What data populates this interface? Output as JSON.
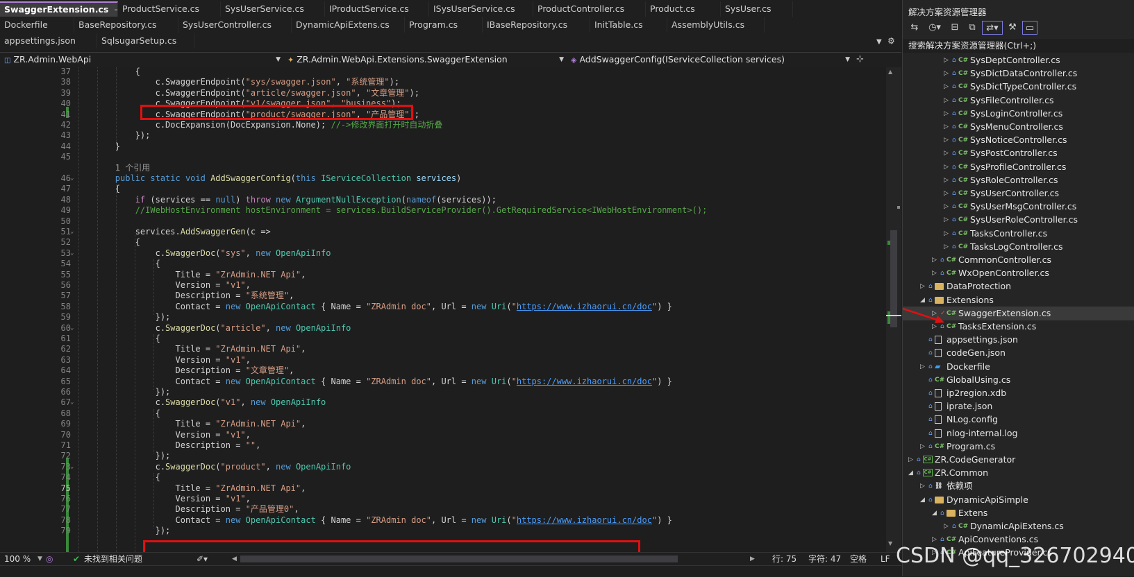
{
  "tabs_row1": [
    "SwaggerExtension.cs",
    "ProductService.cs",
    "SysUserService.cs",
    "IProductService.cs",
    "ISysUserService.cs",
    "ProductController.cs",
    "Product.cs",
    "SysUser.cs"
  ],
  "tabs_row2": [
    "Dockerfile",
    "BaseRepository.cs",
    "SysUserController.cs",
    "DynamicApiExtens.cs",
    "Program.cs",
    "IBaseRepository.cs",
    "InitTable.cs",
    "AssemblyUtils.cs"
  ],
  "tabs_row3": [
    "appsettings.json",
    "SqlsugarSetup.cs"
  ],
  "active_tab_pin": "⊣",
  "active_tab_close": "✕",
  "nav": {
    "project": "ZR.Admin.WebApi",
    "type": "ZR.Admin.WebApi.Extensions.SwaggerExtension",
    "member": "AddSwaggerConfig(IServiceCollection services)"
  },
  "code_lines": [
    {
      "n": "37",
      "html": "            {"
    },
    {
      "n": "38",
      "html": "                c.SwaggerEndpoint(<span class='s'>\"sys/swagger.json\"</span>, <span class='s'>\"系统管理\"</span>);"
    },
    {
      "n": "39",
      "html": "                c.SwaggerEndpoint(<span class='s'>\"article/swagger.json\"</span>, <span class='s'>\"文章管理\"</span>);"
    },
    {
      "n": "40",
      "html": "                c.SwaggerEndpoint(<span class='s'>\"v1/swagger.json\"</span>, <span class='s'>\"business\"</span>);"
    },
    {
      "n": "41",
      "html": "                c.SwaggerEndpoint(<span class='s'>\"product/swagger.json\"</span>, <span class='s'>\"产品管理\"</span>);"
    },
    {
      "n": "42",
      "html": "                c.DocExpansion(DocExpansion.None); <span class='c'>//->修改界面打开时自动折叠</span>"
    },
    {
      "n": "43",
      "html": "            });"
    },
    {
      "n": "44",
      "html": "        }"
    },
    {
      "n": "45",
      "html": ""
    },
    {
      "n": "",
      "html": "        <span style='color:#999'>1 个引用</span>"
    },
    {
      "n": "46",
      "html": "        <span class='k'>public static void</span> <span class='m'>AddSwaggerConfig</span>(<span class='k'>this</span> <span class='t'>IServiceCollection</span> <span class='r'>services</span>)"
    },
    {
      "n": "47",
      "html": "        {"
    },
    {
      "n": "48",
      "html": "            <span class='cl'>if</span> (services == <span class='k'>null</span>) <span class='cl'>throw</span> <span class='k'>new</span> <span class='t'>ArgumentNullException</span>(<span class='k'>nameof</span>(services));"
    },
    {
      "n": "49",
      "html": "            <span class='c'>//IWebHostEnvironment hostEnvironment = services.BuildServiceProvider().GetRequiredService&lt;IWebHostEnvironment&gt;();</span>"
    },
    {
      "n": "50",
      "html": ""
    },
    {
      "n": "51",
      "html": "            services.<span class='m'>AddSwaggerGen</span>(c =&gt;"
    },
    {
      "n": "52",
      "html": "            {"
    },
    {
      "n": "53",
      "html": "                c.<span class='m'>SwaggerDoc</span>(<span class='s'>\"sys\"</span>, <span class='k'>new</span> <span class='t'>OpenApiInfo</span>"
    },
    {
      "n": "54",
      "html": "                {"
    },
    {
      "n": "55",
      "html": "                    Title = <span class='s'>\"ZrAdmin.NET Api\"</span>,"
    },
    {
      "n": "56",
      "html": "                    Version = <span class='s'>\"v1\"</span>,"
    },
    {
      "n": "57",
      "html": "                    Description = <span class='s'>\"系统管理\"</span>,"
    },
    {
      "n": "58",
      "html": "                    Contact = <span class='k'>new</span> <span class='t'>OpenApiContact</span> { Name = <span class='s'>\"ZRAdmin doc\"</span>, Url = <span class='k'>new</span> <span class='t'>Uri</span>(<span class='s'>\"</span><span class='u'>https://www.izhaorui.cn/doc</span><span class='s'>\"</span>) }"
    },
    {
      "n": "59",
      "html": "                });"
    },
    {
      "n": "60",
      "html": "                c.<span class='m'>SwaggerDoc</span>(<span class='s'>\"article\"</span>, <span class='k'>new</span> <span class='t'>OpenApiInfo</span>"
    },
    {
      "n": "61",
      "html": "                {"
    },
    {
      "n": "62",
      "html": "                    Title = <span class='s'>\"ZrAdmin.NET Api\"</span>,"
    },
    {
      "n": "63",
      "html": "                    Version = <span class='s'>\"v1\"</span>,"
    },
    {
      "n": "64",
      "html": "                    Description = <span class='s'>\"文章管理\"</span>,"
    },
    {
      "n": "65",
      "html": "                    Contact = <span class='k'>new</span> <span class='t'>OpenApiContact</span> { Name = <span class='s'>\"ZRAdmin doc\"</span>, Url = <span class='k'>new</span> <span class='t'>Uri</span>(<span class='s'>\"</span><span class='u'>https://www.izhaorui.cn/doc</span><span class='s'>\"</span>) }"
    },
    {
      "n": "66",
      "html": "                });"
    },
    {
      "n": "67",
      "html": "                c.<span class='m'>SwaggerDoc</span>(<span class='s'>\"v1\"</span>, <span class='k'>new</span> <span class='t'>OpenApiInfo</span>"
    },
    {
      "n": "68",
      "html": "                {"
    },
    {
      "n": "69",
      "html": "                    Title = <span class='s'>\"ZrAdmin.NET Api\"</span>,"
    },
    {
      "n": "70",
      "html": "                    Version = <span class='s'>\"v1\"</span>,"
    },
    {
      "n": "71",
      "html": "                    Description = <span class='s'>\"\"</span>,"
    },
    {
      "n": "72",
      "html": "                });"
    },
    {
      "n": "73",
      "html": "                c.<span class='m'>SwaggerDoc</span>(<span class='s'>\"product\"</span>, <span class='k'>new</span> <span class='t'>OpenApiInfo</span>"
    },
    {
      "n": "74",
      "html": "                {"
    },
    {
      "n": "75",
      "html": "                    Title = <span class='s'>\"ZrAdmin.NET Api\"</span>,"
    },
    {
      "n": "76",
      "html": "                    Version = <span class='s'>\"v1\"</span>,"
    },
    {
      "n": "77",
      "html": "                    Description = <span class='s'>\"产品管理0\"</span>,"
    },
    {
      "n": "78",
      "html": "                    Contact = <span class='k'>new</span> <span class='t'>OpenApiContact</span> { Name = <span class='s'>\"ZRAdmin doc\"</span>, Url = <span class='k'>new</span> <span class='t'>Uri</span>(<span class='s'>\"</span><span class='u'>https://www.izhaorui.cn/doc</span><span class='s'>\"</span>) }"
    },
    {
      "n": "79",
      "html": "                });"
    }
  ],
  "current_line": "75",
  "status": {
    "zoom": "100 %",
    "issues": "未找到相关问题",
    "line": "行: 75",
    "col": "字符: 47",
    "spaces": "空格",
    "eol": "LF"
  },
  "solution_explorer": {
    "title": "解决方案资源管理器",
    "search_placeholder": "搜索解决方案资源管理器(Ctrl+;)",
    "nodes": [
      {
        "label": "SysDeptController.cs",
        "depth": 3,
        "icon": "C#",
        "exp": "▷"
      },
      {
        "label": "SysDictDataController.cs",
        "depth": 3,
        "icon": "C#",
        "exp": "▷"
      },
      {
        "label": "SysDictTypeController.cs",
        "depth": 3,
        "icon": "C#",
        "exp": "▷"
      },
      {
        "label": "SysFileController.cs",
        "depth": 3,
        "icon": "C#",
        "exp": "▷"
      },
      {
        "label": "SysLoginController.cs",
        "depth": 3,
        "icon": "C#",
        "exp": "▷"
      },
      {
        "label": "SysMenuController.cs",
        "depth": 3,
        "icon": "C#",
        "exp": "▷"
      },
      {
        "label": "SysNoticeController.cs",
        "depth": 3,
        "icon": "C#",
        "exp": "▷"
      },
      {
        "label": "SysPostController.cs",
        "depth": 3,
        "icon": "C#",
        "exp": "▷"
      },
      {
        "label": "SysProfileController.cs",
        "depth": 3,
        "icon": "C#",
        "exp": "▷"
      },
      {
        "label": "SysRoleController.cs",
        "depth": 3,
        "icon": "C#",
        "exp": "▷"
      },
      {
        "label": "SysUserController.cs",
        "depth": 3,
        "icon": "C#",
        "exp": "▷"
      },
      {
        "label": "SysUserMsgController.cs",
        "depth": 3,
        "icon": "C#",
        "exp": "▷"
      },
      {
        "label": "SysUserRoleController.cs",
        "depth": 3,
        "icon": "C#",
        "exp": "▷"
      },
      {
        "label": "TasksController.cs",
        "depth": 3,
        "icon": "C#",
        "exp": "▷"
      },
      {
        "label": "TasksLogController.cs",
        "depth": 3,
        "icon": "C#",
        "exp": "▷"
      },
      {
        "label": "CommonController.cs",
        "depth": 2,
        "icon": "C#",
        "exp": "▷"
      },
      {
        "label": "WxOpenController.cs",
        "depth": 2,
        "icon": "C#",
        "exp": "▷"
      },
      {
        "label": "DataProtection",
        "depth": 1,
        "icon": "folder",
        "exp": "▷"
      },
      {
        "label": "Extensions",
        "depth": 1,
        "icon": "folder",
        "exp": "◢"
      },
      {
        "label": "SwaggerExtension.cs",
        "depth": 2,
        "icon": "C#",
        "exp": "▷",
        "selected": true
      },
      {
        "label": "TasksExtension.cs",
        "depth": 2,
        "icon": "C#",
        "exp": "▷"
      },
      {
        "label": "appsettings.json",
        "depth": 1,
        "icon": "file",
        "exp": ""
      },
      {
        "label": "codeGen.json",
        "depth": 1,
        "icon": "file",
        "exp": ""
      },
      {
        "label": "Dockerfile",
        "depth": 1,
        "icon": "docker",
        "exp": "▷"
      },
      {
        "label": "GlobalUsing.cs",
        "depth": 1,
        "icon": "C#",
        "exp": ""
      },
      {
        "label": "ip2region.xdb",
        "depth": 1,
        "icon": "file",
        "exp": ""
      },
      {
        "label": "iprate.json",
        "depth": 1,
        "icon": "file",
        "exp": ""
      },
      {
        "label": "NLog.config",
        "depth": 1,
        "icon": "file",
        "exp": ""
      },
      {
        "label": "nlog-internal.log",
        "depth": 1,
        "icon": "file",
        "exp": ""
      },
      {
        "label": "Program.cs",
        "depth": 1,
        "icon": "C#",
        "exp": "▷"
      },
      {
        "label": "ZR.CodeGenerator",
        "depth": 0,
        "icon": "proj",
        "exp": "▷"
      },
      {
        "label": "ZR.Common",
        "depth": 0,
        "icon": "proj",
        "exp": "◢"
      },
      {
        "label": "依赖项",
        "depth": 1,
        "icon": "deps",
        "exp": "▷"
      },
      {
        "label": "DynamicApiSimple",
        "depth": 1,
        "icon": "folder",
        "exp": "◢"
      },
      {
        "label": "Extens",
        "depth": 2,
        "icon": "folder",
        "exp": "◢"
      },
      {
        "label": "DynamicApiExtens.cs",
        "depth": 3,
        "icon": "C#",
        "exp": "▷"
      },
      {
        "label": "ApiConventions.cs",
        "depth": 2,
        "icon": "C#",
        "exp": "▷"
      },
      {
        "label": "ApiFeatureProvider.cs",
        "depth": 2,
        "icon": "C#",
        "exp": "▷"
      }
    ]
  },
  "watermark": "CSDN @qq_326702940"
}
